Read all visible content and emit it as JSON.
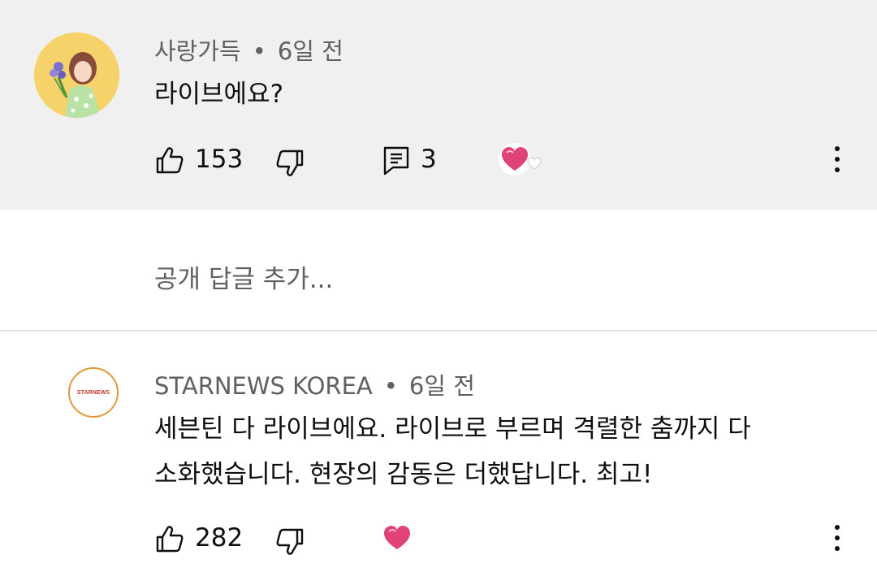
{
  "comments": [
    {
      "author": "사랑가득",
      "separator": "•",
      "time": "6일 전",
      "text": "라이브에요?",
      "likes": "153",
      "replies": "3"
    },
    {
      "author": "STARNEWS KOREA",
      "separator": "•",
      "time": "6일 전",
      "text_line1": "세븐틴 다 라이브에요.  라이브로 부르며 격렬한 춤까지 다",
      "text_line2": "소화했습니다. 현장의 감동은 더했답니다. 최고!",
      "likes": "282",
      "logo_text": "STARNEWS"
    }
  ],
  "reply_box": {
    "placeholder": "공개 답글 추가..."
  },
  "icons": {
    "like": "thumbs-up-icon",
    "dislike": "thumbs-down-icon",
    "reply": "reply-comment-icon",
    "heart": "creator-heart-icon",
    "more": "more-vertical-icon"
  },
  "colors": {
    "highlight_bg": "#f0f0f0",
    "secondary_text": "#606060",
    "heart": "#e0437a"
  }
}
